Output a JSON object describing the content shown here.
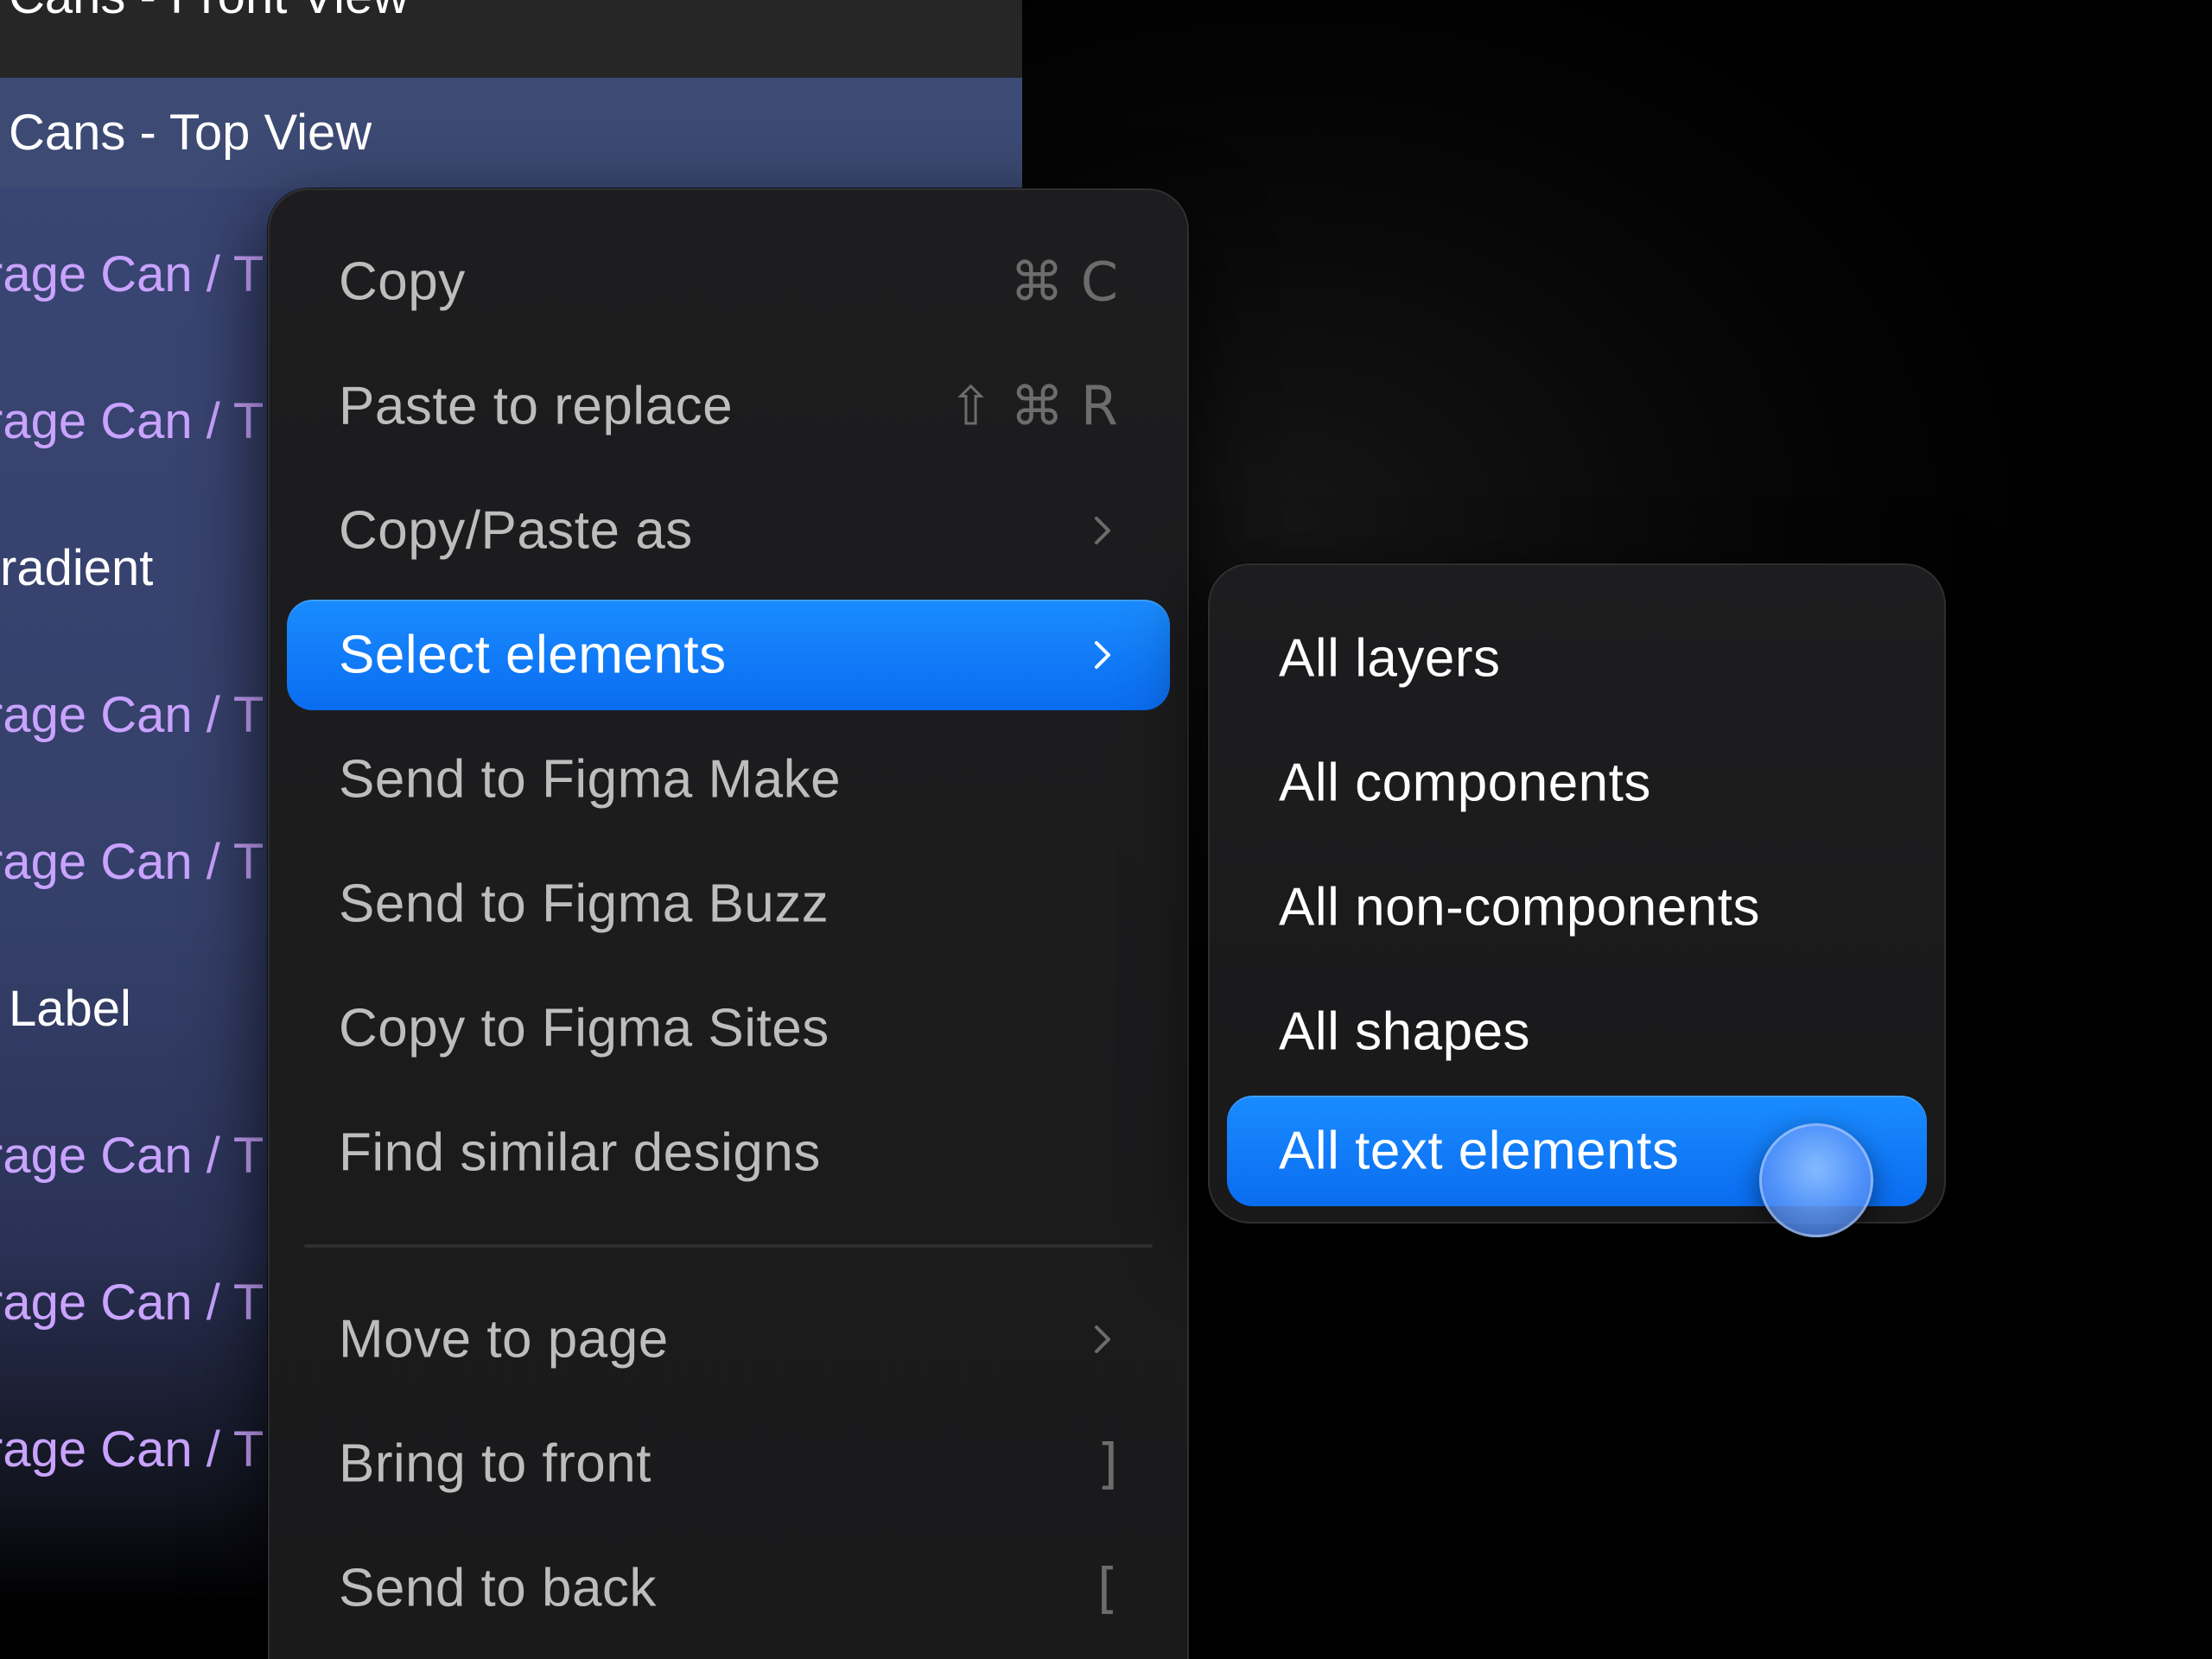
{
  "layers_panel": {
    "prev_row": "Cans - Front View",
    "selected_row": "Cans - Top View",
    "rows": [
      {
        "text": "rage Can / T",
        "kind": "component"
      },
      {
        "text": "rage Can / T",
        "kind": "component"
      },
      {
        "text": "radient",
        "kind": "plain"
      },
      {
        "text": "rage Can / T",
        "kind": "component"
      },
      {
        "text": "rage Can / T",
        "kind": "component"
      },
      {
        "text": "Label",
        "kind": "label"
      },
      {
        "text": "rage Can / T",
        "kind": "component"
      },
      {
        "text": "rage Can / T",
        "kind": "component"
      },
      {
        "text": "rage Can / T",
        "kind": "component"
      }
    ]
  },
  "context_menu": {
    "items": [
      {
        "label": "Copy",
        "shortcut": "⌘ C",
        "submenu": false,
        "active": false
      },
      {
        "label": "Paste to replace",
        "shortcut": "⇧ ⌘ R",
        "submenu": false,
        "active": false
      },
      {
        "label": "Copy/Paste as",
        "shortcut": "",
        "submenu": true,
        "active": false
      },
      {
        "label": "Select elements",
        "shortcut": "",
        "submenu": true,
        "active": true
      },
      {
        "label": "Send to Figma Make",
        "shortcut": "",
        "submenu": false,
        "active": false
      },
      {
        "label": "Send to Figma Buzz",
        "shortcut": "",
        "submenu": false,
        "active": false
      },
      {
        "label": "Copy to Figma Sites",
        "shortcut": "",
        "submenu": false,
        "active": false
      },
      {
        "label": "Find similar designs",
        "shortcut": "",
        "submenu": false,
        "active": false
      },
      {
        "label": "Move to page",
        "shortcut": "",
        "submenu": true,
        "active": false
      },
      {
        "label": "Bring to front",
        "shortcut": "]",
        "submenu": false,
        "active": false
      },
      {
        "label": "Send to back",
        "shortcut": "[",
        "submenu": false,
        "active": false
      }
    ]
  },
  "submenu": {
    "items": [
      {
        "label": "All layers",
        "active": false
      },
      {
        "label": "All components",
        "active": false
      },
      {
        "label": "All non-components",
        "active": false
      },
      {
        "label": "All shapes",
        "active": false
      },
      {
        "label": "All text elements",
        "active": true
      }
    ]
  },
  "colors": {
    "accent": "#0a7cff",
    "component_text": "#c9a3ff",
    "menu_bg": "#1b1b1d",
    "selected_row_bg": "#3c4a74"
  }
}
